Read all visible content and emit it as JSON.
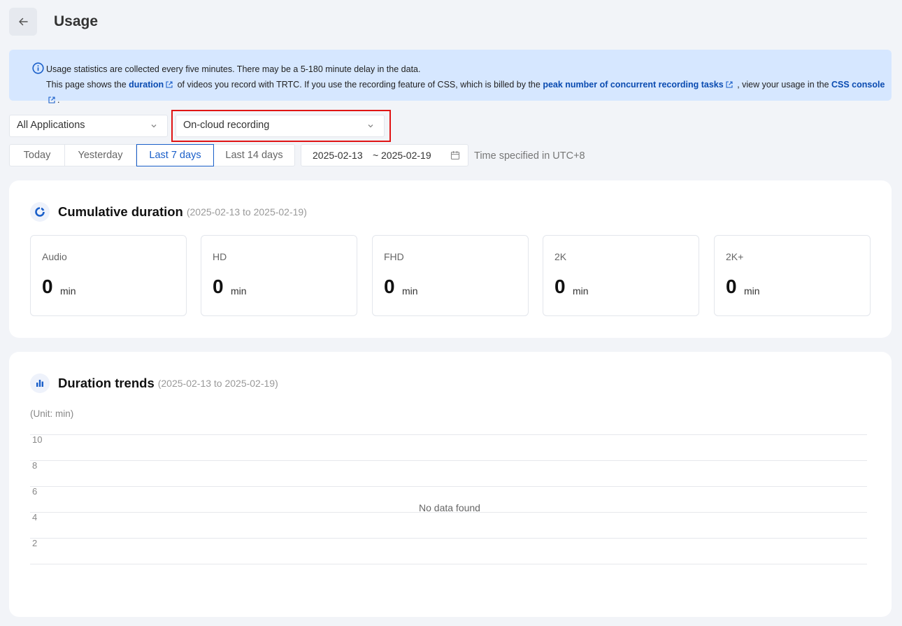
{
  "header": {
    "title": "Usage",
    "back_icon": "arrow-left-icon"
  },
  "notice": {
    "line1": "Usage statistics are collected every five minutes. There may be a 5-180 minute delay in the data.",
    "line2_a": "This page shows the ",
    "link_duration": "duration",
    "line2_b": " of videos you record with TRTC. If you use the recording feature of CSS, which is billed by the ",
    "link_peak": "peak number of concurrent recording tasks",
    "line2_c": " , view your usage in the ",
    "link_console": "CSS console",
    "line2_d": ".",
    "accent": "#0a4bb0",
    "background": "#d6e7ff"
  },
  "filters": {
    "application": "All Applications",
    "recording_type": "On-cloud recording",
    "ranges": [
      "Today",
      "Yesterday",
      "Last 7 days",
      "Last 14 days"
    ],
    "active_range": "Last 7 days",
    "date_start": "2025-02-13",
    "date_sep": "~",
    "date_end": "2025-02-19",
    "timezone": "Time specified in UTC+8"
  },
  "cumulative": {
    "title": "Cumulative duration",
    "range": "(2025-02-13 to 2025-02-19)",
    "metrics": [
      {
        "label": "Audio",
        "value": "0",
        "unit": "min"
      },
      {
        "label": "HD",
        "value": "0",
        "unit": "min"
      },
      {
        "label": "FHD",
        "value": "0",
        "unit": "min"
      },
      {
        "label": "2K",
        "value": "0",
        "unit": "min"
      },
      {
        "label": "2K+",
        "value": "0",
        "unit": "min"
      }
    ]
  },
  "trends": {
    "title": "Duration trends",
    "range": "(2025-02-13 to 2025-02-19)",
    "unit": "(Unit: min)",
    "yticks": [
      "10",
      "8",
      "6",
      "4",
      "2"
    ],
    "empty": "No data found"
  },
  "colors": {
    "primary": "#1a5fc9",
    "highlight": "#e01414"
  }
}
